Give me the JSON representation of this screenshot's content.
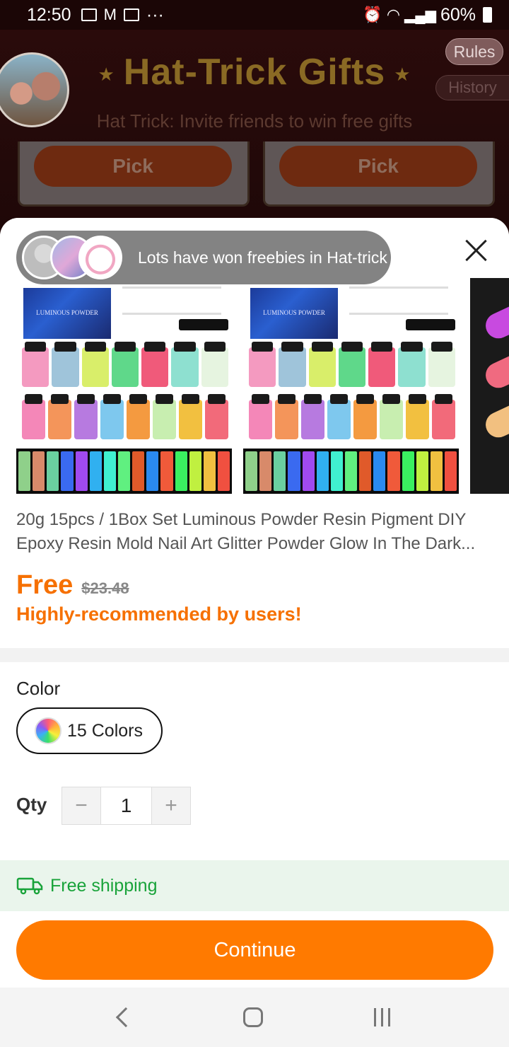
{
  "status_bar": {
    "time": "12:50",
    "more": "···",
    "battery": "60%"
  },
  "background": {
    "title": "Hat-Trick Gifts",
    "subtitle": "Hat Trick: Invite friends to win free gifts",
    "rules_label": "Rules",
    "history_label": "History",
    "pick_label": "Pick"
  },
  "sheet": {
    "winners_text": "Lots have won freebies in Hat-trick",
    "product_title": "20g 15pcs / 1Box Set Luminous Powder Resin Pigment DIY Epoxy Resin Mold Nail Art Glitter Powder Glow In The Dark...",
    "price_free": "Free",
    "price_original": "$23.48",
    "recommendation": "Highly-recommended by users!",
    "image_box_text": "LUMINOUS POWDER",
    "color_label": "Color",
    "color_option": "15 Colors",
    "qty_label": "Qty",
    "qty_minus": "−",
    "qty_value": "1",
    "qty_plus": "+",
    "shipping_text": "Free shipping",
    "continue_label": "Continue"
  },
  "colors": {
    "accent": "#ff7a00",
    "price": "#f67000",
    "shipping_green": "#19a33a"
  }
}
